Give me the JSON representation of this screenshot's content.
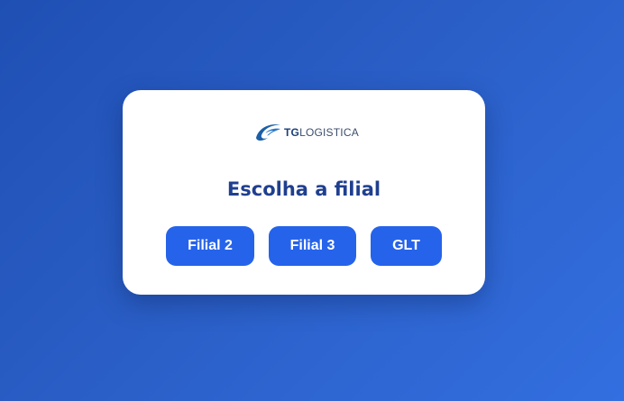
{
  "logo": {
    "brand_bold": "TG",
    "brand_light": "LOGISTICA",
    "icon": "tg-logistica-swoosh-logo",
    "colors": {
      "mark": "#1b5fa8",
      "text": "#1b3e7a"
    }
  },
  "title": "Escolha a filial",
  "buttons": [
    {
      "label": "Filial 2"
    },
    {
      "label": "Filial 3"
    },
    {
      "label": "GLT"
    }
  ],
  "colors": {
    "background_start": "#1f4fb3",
    "background_end": "#336fe0",
    "button": "#2563eb",
    "title": "#1f3f8f"
  }
}
